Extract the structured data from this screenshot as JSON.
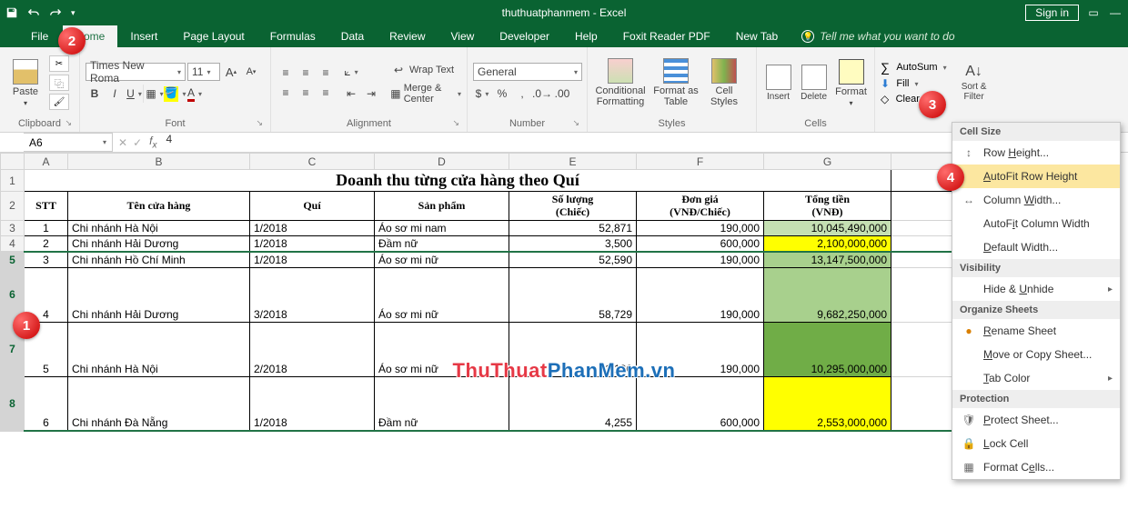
{
  "title": "thuthuatphanmem - Excel",
  "signin": "Sign in",
  "tabs": {
    "file": "File",
    "items": [
      "Home",
      "Insert",
      "Page Layout",
      "Formulas",
      "Data",
      "Review",
      "View",
      "Developer",
      "Help",
      "Foxit Reader PDF",
      "New Tab"
    ],
    "active": "Home",
    "tellme": "Tell me what you want to do"
  },
  "ribbon": {
    "clipboard": {
      "label": "Clipboard",
      "paste": "Paste"
    },
    "font": {
      "label": "Font",
      "name": "Times New Roma",
      "size": "11",
      "bold": "B",
      "italic": "I",
      "underline": "U",
      "grow": "A",
      "shrink": "A"
    },
    "alignment": {
      "label": "Alignment",
      "wrap": "Wrap Text",
      "merge": "Merge & Center"
    },
    "number": {
      "label": "Number",
      "format": "General"
    },
    "styles": {
      "label": "Styles",
      "cond": "Conditional\nFormatting",
      "table": "Format as\nTable",
      "cell": "Cell\nStyles"
    },
    "cells": {
      "label": "Cells",
      "insert": "Insert",
      "delete": "Delete",
      "format": "Format"
    },
    "editing": {
      "label": "Editing",
      "autosum": "AutoSum",
      "fill": "Fill",
      "clear": "Clear",
      "sort": "Sort &\nFilter"
    }
  },
  "namebox": "A6",
  "formula": "4",
  "menu": {
    "s1": "Cell Size",
    "row_height": "Row Height...",
    "autofit_row": "AutoFit Row Height",
    "col_width": "Column Width...",
    "autofit_col": "AutoFit Column Width",
    "default_width": "Default Width...",
    "s2": "Visibility",
    "hide": "Hide & Unhide",
    "s3": "Organize Sheets",
    "rename": "Rename Sheet",
    "move": "Move or Copy Sheet...",
    "tabcolor": "Tab Color",
    "s4": "Protection",
    "protect": "Protect Sheet...",
    "lock": "Lock Cell",
    "format_cells": "Format Cells..."
  },
  "columns": [
    "A",
    "B",
    "C",
    "D",
    "E",
    "F",
    "G"
  ],
  "table": {
    "title": "Doanh thu từng cửa hàng theo Quí",
    "headers": {
      "stt": "STT",
      "ten": "Tên cửa hàng",
      "qui": "Quí",
      "sp": "Sản phẩm",
      "sl": "Số lượng\n(Chiếc)",
      "dg": "Đơn giá\n(VNĐ/Chiếc)",
      "tt": "Tổng tiền\n(VNĐ)"
    },
    "rows": [
      {
        "stt": "1",
        "ten": "Chi nhánh Hà Nội",
        "qui": "1/2018",
        "sp": "Áo sơ mi nam",
        "sl": "52,871",
        "dg": "190,000",
        "tt": "10,045,490,000",
        "cls": "g-light"
      },
      {
        "stt": "2",
        "ten": "Chi nhánh Hải Dương",
        "qui": "1/2018",
        "sp": "Đầm nữ",
        "sl": "3,500",
        "dg": "600,000",
        "tt": "2,100,000,000",
        "cls": "yellow"
      },
      {
        "stt": "3",
        "ten": "Chi nhánh Hồ Chí Minh",
        "qui": "1/2018",
        "sp": "Áo sơ mi nữ",
        "sl": "52,590",
        "dg": "190,000",
        "tt": "13,147,500,000",
        "cls": "g-dark"
      },
      {
        "stt": "4",
        "ten": "Chi nhánh Hải Dương",
        "qui": "3/2018",
        "sp": "Áo sơ mi nữ",
        "sl": "58,729",
        "dg": "190,000",
        "tt": "9,682,250,000",
        "cls": "g-dark",
        "tall": true
      },
      {
        "stt": "5",
        "ten": "Chi nhánh Hà Nội",
        "qui": "2/2018",
        "sp": "Áo sơ mi nữ",
        "sl": "41,180",
        "dg": "190,000",
        "tt": "10,295,000,000",
        "cls": "g-vdark",
        "tall": true
      },
      {
        "stt": "6",
        "ten": "Chi nhánh Đà Nẵng",
        "qui": "1/2018",
        "sp": "Đầm nữ",
        "sl": "4,255",
        "dg": "600,000",
        "tt": "2,553,000,000",
        "cls": "yellow",
        "tall": true
      }
    ]
  },
  "markers": {
    "m1": "1",
    "m2": "2",
    "m3": "3",
    "m4": "4"
  },
  "watermark": {
    "p1": "ThuThuat",
    "p2": "PhanMem",
    "p3": ".vn"
  }
}
